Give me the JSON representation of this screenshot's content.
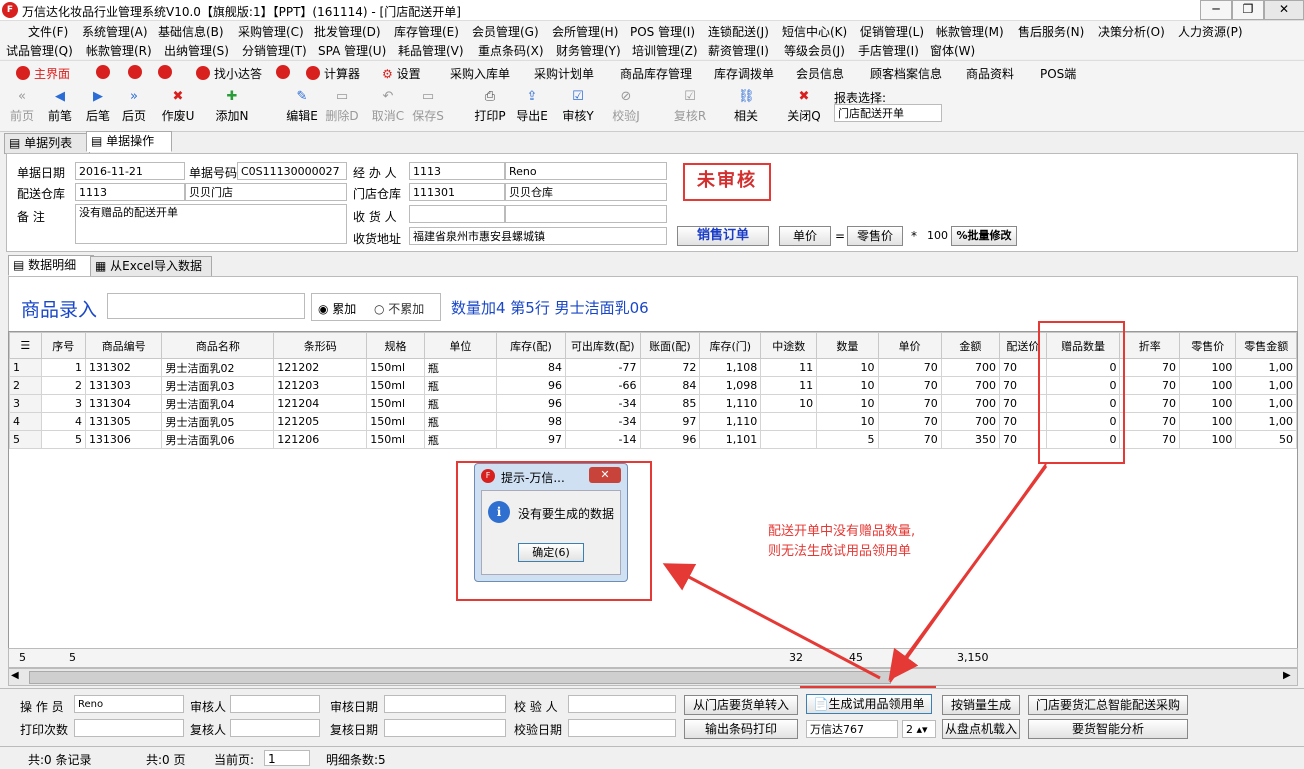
{
  "window": {
    "title": "万信达化妆品行业管理系统V10.0【旗舰版:1】【PPT】(161114) - [门店配送开单]"
  },
  "menu1": [
    "文件(F)",
    "系统管理(A)",
    "基础信息(B)",
    "采购管理(C)",
    "批发管理(D)",
    "库存管理(E)",
    "会员管理(G)",
    "会所管理(H)",
    "POS 管理(I)",
    "连锁配送(J)",
    "短信中心(K)",
    "促销管理(L)",
    "帐款管理(M)",
    "售后服务(N)",
    "决策分析(O)",
    "人力资源(P)"
  ],
  "menu2": [
    "试品管理(Q)",
    "帐款管理(R)",
    "出纳管理(S)",
    "分销管理(T)",
    "SPA 管理(U)",
    "耗品管理(V)",
    "重点条码(X)",
    "财务管理(Y)",
    "培训管理(Z)",
    "薪资管理(I)",
    "等级会员(J)",
    "手店管理(I)",
    "窗体(W)"
  ],
  "quickbar": [
    "主界面",
    "找小达答",
    "计算器",
    "设置",
    "采购入库单",
    "采购计划单",
    "商品库存管理",
    "库存调拨单",
    "会员信息",
    "顾客档案信息",
    "商品资料",
    "POS端"
  ],
  "toolbar": [
    "前页",
    "前笔",
    "后笔",
    "后页",
    "作废U",
    "添加N",
    "编辑E",
    "删除D",
    "取消C",
    "保存S",
    "打印P",
    "导出E",
    "审核Y",
    "校验J",
    "复核R",
    "相关",
    "关闭Q"
  ],
  "report": {
    "label": "报表选择:",
    "value": "门店配送开单"
  },
  "tabs": {
    "list": "单据列表",
    "ops": "单据操作"
  },
  "form": {
    "date_label": "单据日期",
    "date": "2016-11-21",
    "no_label": "单据号码",
    "no": "C0S11130000027",
    "handler_label": "经 办 人",
    "handler_code": "1113",
    "handler_name": "Reno",
    "dist_label": "配送仓库",
    "dist_code": "1113",
    "dist_name": "贝贝门店",
    "store_label": "门店仓库",
    "store_code": "111301",
    "store_name": "贝贝仓库",
    "note_label": "备    注",
    "note": "没有赠品的配送开单",
    "receiver_label": "收 货 人",
    "receiver": "",
    "address_label": "收货地址",
    "address": "福建省泉州市惠安县螺城镇",
    "status": "未审核",
    "sales_order": "销售订单",
    "unit_price": "单价",
    "eq": "=",
    "retail_price": "零售价",
    "mult": "*",
    "factor": "100",
    "batch_edit": "%批量修改"
  },
  "subtabs": {
    "detail": "数据明细",
    "excel": "从Excel导入数据"
  },
  "entry": {
    "label": "商品录入",
    "opt1": "累加",
    "opt2": "不累加",
    "info": "数量加4  第5行   男士洁面乳06"
  },
  "columns": [
    "序号",
    "商品编号",
    "商品名称",
    "条形码",
    "规格",
    "单位",
    "库存(配)",
    "可出库数(配)",
    "账面(配)",
    "库存(门)",
    "中途数",
    "数量",
    "单价",
    "金额",
    "配送价",
    "赠品数量",
    "折率",
    "零售价",
    "零售金额"
  ],
  "rows": [
    [
      "1",
      "1",
      "131302",
      "男士洁面乳02",
      "121202",
      "150ml",
      "瓶",
      "84",
      "-77",
      "72",
      "1,108",
      "11",
      "10",
      "70",
      "700",
      "70",
      "0",
      "70",
      "100",
      "1,00"
    ],
    [
      "2",
      "2",
      "131303",
      "男士洁面乳03",
      "121203",
      "150ml",
      "瓶",
      "96",
      "-66",
      "84",
      "1,098",
      "11",
      "10",
      "70",
      "700",
      "70",
      "0",
      "70",
      "100",
      "1,00"
    ],
    [
      "3",
      "3",
      "131304",
      "男士洁面乳04",
      "121204",
      "150ml",
      "瓶",
      "96",
      "-34",
      "85",
      "1,110",
      "10",
      "10",
      "70",
      "700",
      "70",
      "0",
      "70",
      "100",
      "1,00"
    ],
    [
      "4",
      "4",
      "131305",
      "男士洁面乳05",
      "121205",
      "150ml",
      "瓶",
      "98",
      "-34",
      "97",
      "1,110",
      "",
      "10",
      "70",
      "700",
      "70",
      "0",
      "70",
      "100",
      "1,00"
    ],
    [
      "5",
      "5",
      "131306",
      "男士洁面乳06",
      "121206",
      "150ml",
      "瓶",
      "97",
      "-14",
      "96",
      "1,101",
      "",
      "5",
      "70",
      "350",
      "70",
      "0",
      "70",
      "100",
      "50"
    ]
  ],
  "footer": {
    "count": "5",
    "count2": "5",
    "sum1": "32",
    "sum2": "45",
    "sum3": "3,150"
  },
  "dialog": {
    "title": "提示-万信...",
    "message": "没有要生成的数据",
    "ok": "确定(6)"
  },
  "annotation": "配送开单中没有赠品数量,\n则无法生成试用品领用单",
  "bottom": {
    "operator_label": "操 作 员",
    "operator": "Reno",
    "auditor_label": "审核人",
    "audit_date_label": "审核日期",
    "checker_label": "校 验 人",
    "print_label": "打印次数",
    "reviewer_label": "复核人",
    "review_date_label": "复核日期",
    "check_date_label": "校验日期",
    "btn_transfer": "从门店要货单转入",
    "btn_gen_trial": "生成试用品领用单",
    "btn_sales_gen": "按销量生成",
    "btn_smart": "门店要货汇总智能配送采购",
    "btn_print_barcode": "输出条码打印",
    "combo": "万信达767",
    "combo_num": "2",
    "btn_import": "从盘点机载入",
    "btn_analysis": "要货智能分析"
  },
  "status": {
    "records": "共:0 条记录",
    "pages": "共:0 页",
    "current_label": "当前页:",
    "current": "1",
    "detail_count": "明细条数:5"
  }
}
